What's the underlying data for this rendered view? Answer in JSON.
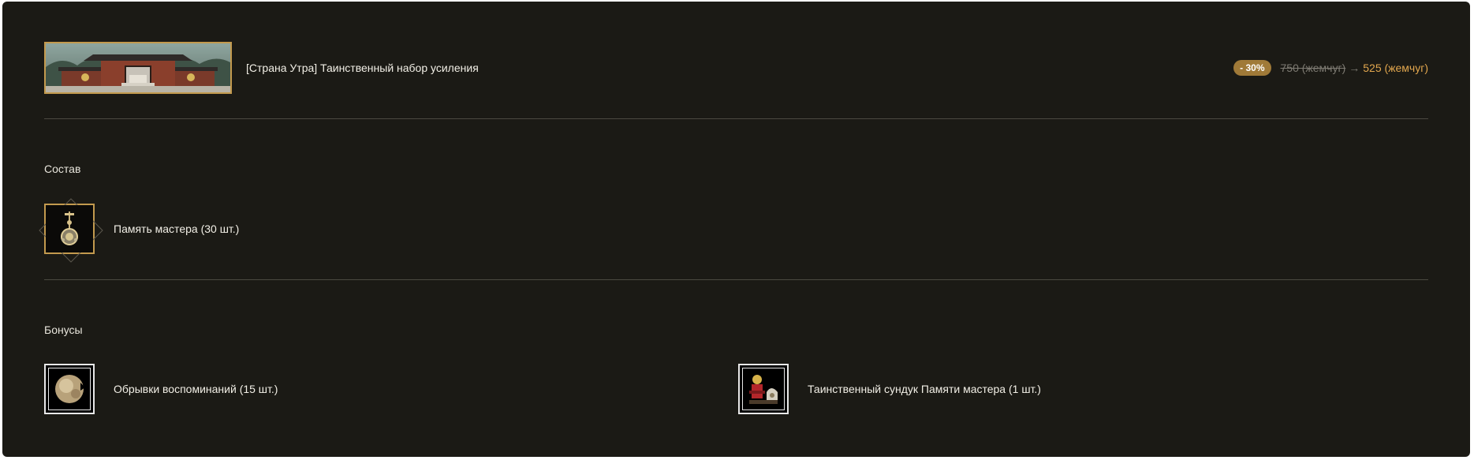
{
  "header": {
    "title": "[Страна Утра] Таинственный набор усиления",
    "discount_badge": "- 30%",
    "old_price": "750 (жемчуг)",
    "arrow": "→",
    "new_price": "525 (жемчуг)"
  },
  "composition": {
    "title": "Состав",
    "items": [
      {
        "label": "Память мастера (30 шт.)",
        "icon": "pendant-icon"
      }
    ]
  },
  "bonuses": {
    "title": "Бонусы",
    "items": [
      {
        "label": "Обрывки воспоминаний (15 шт.)",
        "icon": "memory-fragment-icon"
      },
      {
        "label": "Таинственный сундук Памяти мастера (1 шт.)",
        "icon": "mystery-chest-icon"
      }
    ]
  },
  "colors": {
    "background": "#1b1a15",
    "accent_gold": "#c39a4e",
    "new_price": "#e2a74e",
    "old_price": "#7d7a72",
    "discount_badge": "#a07a38"
  }
}
